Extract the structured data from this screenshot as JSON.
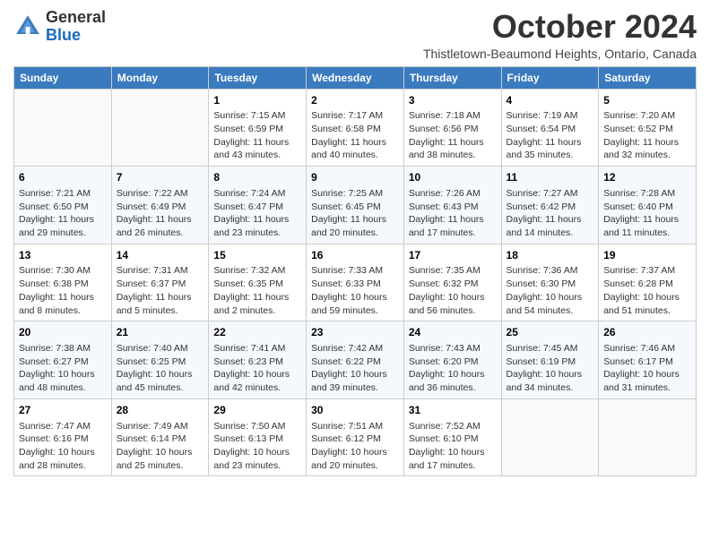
{
  "header": {
    "logo_general": "General",
    "logo_blue": "Blue",
    "month_title": "October 2024",
    "location": "Thistletown-Beaumond Heights, Ontario, Canada"
  },
  "days_of_week": [
    "Sunday",
    "Monday",
    "Tuesday",
    "Wednesday",
    "Thursday",
    "Friday",
    "Saturday"
  ],
  "weeks": [
    [
      {
        "day": "",
        "info": ""
      },
      {
        "day": "",
        "info": ""
      },
      {
        "day": "1",
        "info": "Sunrise: 7:15 AM\nSunset: 6:59 PM\nDaylight: 11 hours and 43 minutes."
      },
      {
        "day": "2",
        "info": "Sunrise: 7:17 AM\nSunset: 6:58 PM\nDaylight: 11 hours and 40 minutes."
      },
      {
        "day": "3",
        "info": "Sunrise: 7:18 AM\nSunset: 6:56 PM\nDaylight: 11 hours and 38 minutes."
      },
      {
        "day": "4",
        "info": "Sunrise: 7:19 AM\nSunset: 6:54 PM\nDaylight: 11 hours and 35 minutes."
      },
      {
        "day": "5",
        "info": "Sunrise: 7:20 AM\nSunset: 6:52 PM\nDaylight: 11 hours and 32 minutes."
      }
    ],
    [
      {
        "day": "6",
        "info": "Sunrise: 7:21 AM\nSunset: 6:50 PM\nDaylight: 11 hours and 29 minutes."
      },
      {
        "day": "7",
        "info": "Sunrise: 7:22 AM\nSunset: 6:49 PM\nDaylight: 11 hours and 26 minutes."
      },
      {
        "day": "8",
        "info": "Sunrise: 7:24 AM\nSunset: 6:47 PM\nDaylight: 11 hours and 23 minutes."
      },
      {
        "day": "9",
        "info": "Sunrise: 7:25 AM\nSunset: 6:45 PM\nDaylight: 11 hours and 20 minutes."
      },
      {
        "day": "10",
        "info": "Sunrise: 7:26 AM\nSunset: 6:43 PM\nDaylight: 11 hours and 17 minutes."
      },
      {
        "day": "11",
        "info": "Sunrise: 7:27 AM\nSunset: 6:42 PM\nDaylight: 11 hours and 14 minutes."
      },
      {
        "day": "12",
        "info": "Sunrise: 7:28 AM\nSunset: 6:40 PM\nDaylight: 11 hours and 11 minutes."
      }
    ],
    [
      {
        "day": "13",
        "info": "Sunrise: 7:30 AM\nSunset: 6:38 PM\nDaylight: 11 hours and 8 minutes."
      },
      {
        "day": "14",
        "info": "Sunrise: 7:31 AM\nSunset: 6:37 PM\nDaylight: 11 hours and 5 minutes."
      },
      {
        "day": "15",
        "info": "Sunrise: 7:32 AM\nSunset: 6:35 PM\nDaylight: 11 hours and 2 minutes."
      },
      {
        "day": "16",
        "info": "Sunrise: 7:33 AM\nSunset: 6:33 PM\nDaylight: 10 hours and 59 minutes."
      },
      {
        "day": "17",
        "info": "Sunrise: 7:35 AM\nSunset: 6:32 PM\nDaylight: 10 hours and 56 minutes."
      },
      {
        "day": "18",
        "info": "Sunrise: 7:36 AM\nSunset: 6:30 PM\nDaylight: 10 hours and 54 minutes."
      },
      {
        "day": "19",
        "info": "Sunrise: 7:37 AM\nSunset: 6:28 PM\nDaylight: 10 hours and 51 minutes."
      }
    ],
    [
      {
        "day": "20",
        "info": "Sunrise: 7:38 AM\nSunset: 6:27 PM\nDaylight: 10 hours and 48 minutes."
      },
      {
        "day": "21",
        "info": "Sunrise: 7:40 AM\nSunset: 6:25 PM\nDaylight: 10 hours and 45 minutes."
      },
      {
        "day": "22",
        "info": "Sunrise: 7:41 AM\nSunset: 6:23 PM\nDaylight: 10 hours and 42 minutes."
      },
      {
        "day": "23",
        "info": "Sunrise: 7:42 AM\nSunset: 6:22 PM\nDaylight: 10 hours and 39 minutes."
      },
      {
        "day": "24",
        "info": "Sunrise: 7:43 AM\nSunset: 6:20 PM\nDaylight: 10 hours and 36 minutes."
      },
      {
        "day": "25",
        "info": "Sunrise: 7:45 AM\nSunset: 6:19 PM\nDaylight: 10 hours and 34 minutes."
      },
      {
        "day": "26",
        "info": "Sunrise: 7:46 AM\nSunset: 6:17 PM\nDaylight: 10 hours and 31 minutes."
      }
    ],
    [
      {
        "day": "27",
        "info": "Sunrise: 7:47 AM\nSunset: 6:16 PM\nDaylight: 10 hours and 28 minutes."
      },
      {
        "day": "28",
        "info": "Sunrise: 7:49 AM\nSunset: 6:14 PM\nDaylight: 10 hours and 25 minutes."
      },
      {
        "day": "29",
        "info": "Sunrise: 7:50 AM\nSunset: 6:13 PM\nDaylight: 10 hours and 23 minutes."
      },
      {
        "day": "30",
        "info": "Sunrise: 7:51 AM\nSunset: 6:12 PM\nDaylight: 10 hours and 20 minutes."
      },
      {
        "day": "31",
        "info": "Sunrise: 7:52 AM\nSunset: 6:10 PM\nDaylight: 10 hours and 17 minutes."
      },
      {
        "day": "",
        "info": ""
      },
      {
        "day": "",
        "info": ""
      }
    ]
  ]
}
